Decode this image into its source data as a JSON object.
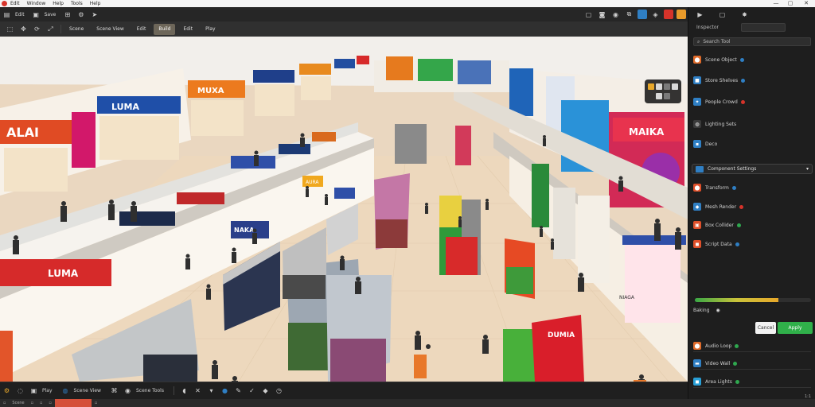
{
  "menu": {
    "items": [
      "Edit",
      "Window",
      "Help",
      "",
      "",
      "Tools",
      "Help"
    ],
    "window_controls": [
      "—",
      "▢",
      "✕"
    ]
  },
  "toolbar1": {
    "items": [
      {
        "icon": "folder-icon",
        "label": "Edit"
      },
      {
        "icon": "save-icon",
        "label": "Save"
      },
      {
        "icon": "grid-icon",
        "label": ""
      },
      {
        "icon": "settings-icon",
        "label": ""
      },
      {
        "icon": "arrow-icon",
        "label": ""
      }
    ]
  },
  "toolbar2": {
    "tools": [
      {
        "icon": "select-icon",
        "label": ""
      },
      {
        "icon": "move-icon",
        "label": ""
      },
      {
        "icon": "rotate-icon",
        "label": ""
      },
      {
        "icon": "scale-icon",
        "label": ""
      }
    ],
    "modes": [
      {
        "label": "Scene",
        "active": false
      },
      {
        "label": "Scene View",
        "active": false
      },
      {
        "label": "Edit",
        "active": false
      },
      {
        "label": "Build",
        "active": true
      },
      {
        "label": "Edit",
        "active": false
      },
      {
        "label": "Play",
        "active": false
      }
    ]
  },
  "viewport": {
    "signs": [
      "ALAI",
      "LUMA",
      "MUXA",
      "LUMA",
      "MAIKA",
      "DUMIA",
      "NAKA",
      "AURA",
      "NIAGA"
    ]
  },
  "bottombar": {
    "items": [
      {
        "icon": "gear-icon",
        "label": ""
      },
      {
        "icon": "sync-icon",
        "label": "Play"
      },
      {
        "icon": "play-icon",
        "label": "Scene View"
      },
      {
        "icon": "code-icon",
        "label": ""
      },
      {
        "icon": "tag-icon",
        "label": "Scene Tools"
      }
    ],
    "tool_icons": [
      "chat-icon",
      "close-icon",
      "pin-icon",
      "brush-icon",
      "check-icon",
      "tag-icon",
      "clock-icon"
    ]
  },
  "statusbar": {
    "tabs": [
      "Scene",
      "",
      "",
      "",
      "",
      ""
    ]
  },
  "rightpanel": {
    "header_icons": [
      "play-icon",
      "copy-icon",
      "bug-icon"
    ],
    "title": "Inspector",
    "search_placeholder": "Search Tool",
    "rows": [
      {
        "icon": "flame-icon",
        "color": "#e06b2a",
        "label": "Scene Object",
        "dot": "#2f7fc4"
      },
      {
        "icon": "box-icon",
        "color": "#2f7fc4",
        "label": "Store Shelves",
        "dot": "#2f7fc4"
      },
      {
        "icon": "bird-icon",
        "color": "#2f7fc4",
        "label": "People Crowd",
        "dot": "#d6332a"
      },
      {
        "icon": "globe-icon",
        "color": "#3a3a3a",
        "label": "Lighting Sets",
        "dot": ""
      },
      {
        "icon": "square-icon",
        "color": "#2f7fc4",
        "label": "Deco",
        "dot": ""
      }
    ],
    "section_title": "Component Settings",
    "items": [
      {
        "icon": "flame-icon",
        "color": "#e0502a",
        "label": "Transform",
        "dot": "#2f7fc4"
      },
      {
        "icon": "mesh-icon",
        "color": "#2f7fc4",
        "label": "Mesh Render",
        "dot": "#d6332a"
      },
      {
        "icon": "collider-icon",
        "color": "#e0502a",
        "label": "Box Collider",
        "dot": "#2fa84f"
      },
      {
        "icon": "script-icon",
        "color": "#e0502a",
        "label": "Script Data",
        "dot": "#2f7fc4"
      }
    ],
    "progress": 0.72,
    "progress_label": "Baking",
    "buttons": [
      "Cancel",
      "Apply"
    ],
    "lower": [
      {
        "icon": "flame-icon",
        "color": "#e06b2a",
        "label": "Audio Loop",
        "dot": "#2fa84f"
      },
      {
        "icon": "screen-icon",
        "color": "#2f7fc4",
        "label": "Video Wall",
        "dot": "#2fa84f"
      },
      {
        "icon": "light-icon",
        "color": "#29a0d8",
        "label": "Area Lights",
        "dot": "#2fa84f"
      }
    ],
    "status": "1:1"
  }
}
